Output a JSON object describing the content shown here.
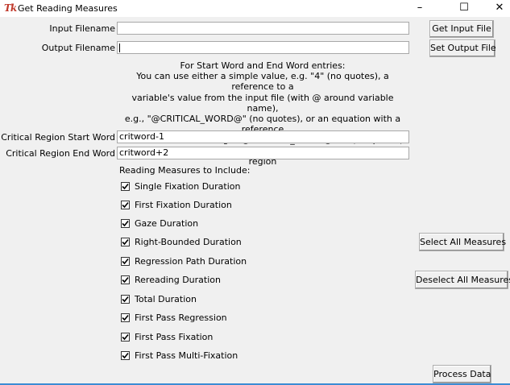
{
  "window": {
    "title": "Get Reading Measures",
    "icon_text": "Tk",
    "minimize": "–",
    "maximize": "☐",
    "close": "✕"
  },
  "input_file": {
    "label": "Input Filename",
    "value": "",
    "button": "Get Input File"
  },
  "output_file": {
    "label": "Output Filename",
    "value": "",
    "button": "Set Output File"
  },
  "instructions": [
    "For Start Word and End Word entries:",
    "You can use either a simple value, e.g. \"4\" (no quotes), a reference to a",
    "variable's value from the input file (with @ around variable name),",
    "e.g., \"@CRITICAL_WORD@\" (no quotes), or an equation with a reference",
    "to a variable's value, e.g., \"@CRITICAL_WORD@+2\" (no quotes).",
    "Note: Start Word and End Word should be the same for a 1-word region"
  ],
  "start_word": {
    "label": "Critical Region Start Word",
    "value": "critword-1"
  },
  "end_word": {
    "label": "Critical Region End Word",
    "value": "critword+2"
  },
  "measures_heading": "Reading Measures to Include:",
  "measures": [
    {
      "label": "Single Fixation Duration",
      "checked": true
    },
    {
      "label": "First Fixation Duration",
      "checked": true
    },
    {
      "label": "Gaze Duration",
      "checked": true
    },
    {
      "label": "Right-Bounded Duration",
      "checked": true
    },
    {
      "label": "Regression Path Duration",
      "checked": true
    },
    {
      "label": "Rereading Duration",
      "checked": true
    },
    {
      "label": "Total Duration",
      "checked": true
    },
    {
      "label": "First Pass Regression",
      "checked": true
    },
    {
      "label": "First Pass Fixation",
      "checked": true
    },
    {
      "label": "First Pass Multi-Fixation",
      "checked": true
    }
  ],
  "buttons": {
    "select_all": "Select All Measures",
    "deselect_all": "Deselect All Measures",
    "process": "Process Data"
  },
  "colors": {
    "accent_line": "#3c8cd4",
    "icon": "#c0392b",
    "background": "#f0f0f0"
  }
}
